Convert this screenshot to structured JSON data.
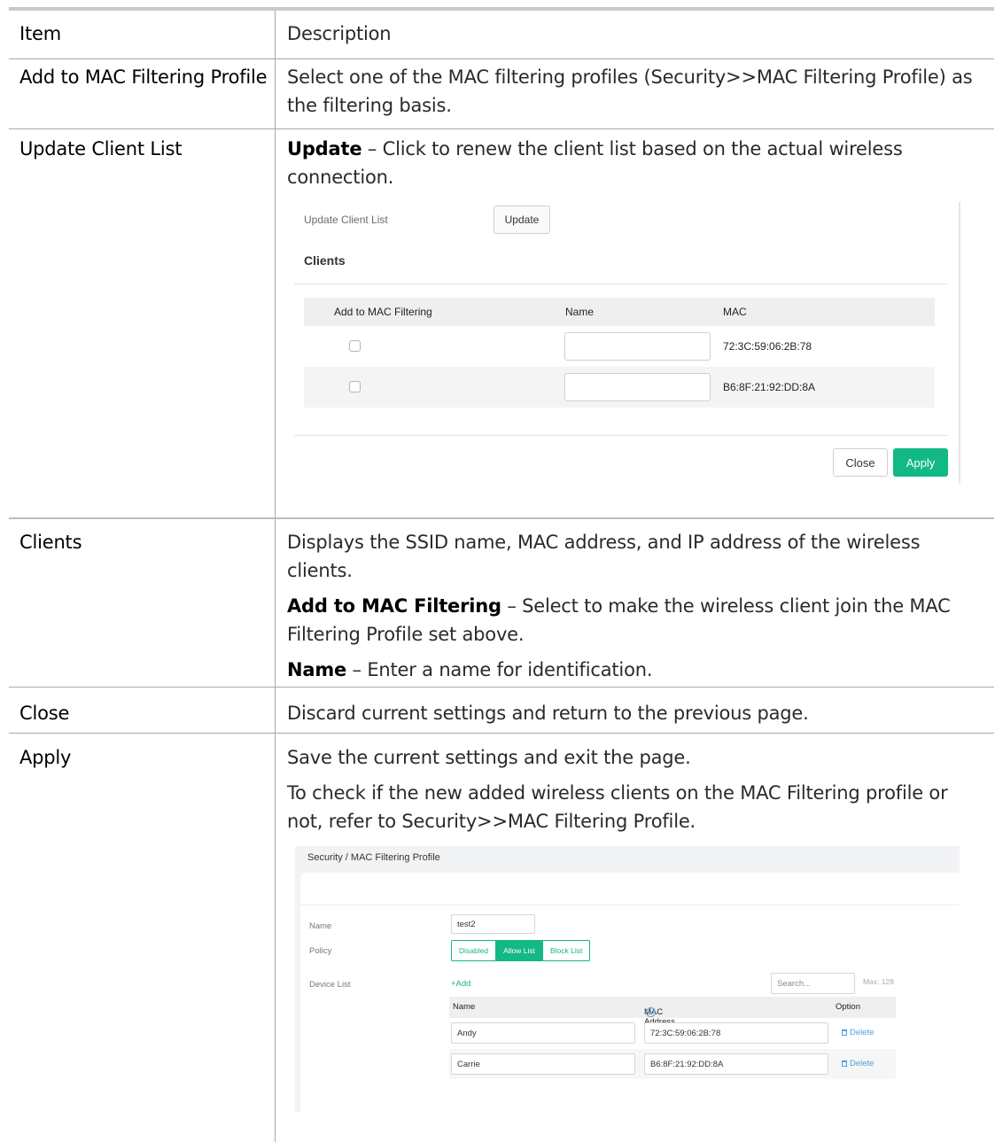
{
  "table": {
    "headers": {
      "item": "Item",
      "description": "Description"
    },
    "rows": [
      {
        "item": "Add to MAC Filtering Profile",
        "description": "Select one of the MAC filtering profiles (Security>>MAC Filtering Profile) as the filtering basis."
      },
      {
        "item": "Update Client List",
        "term": "Update",
        "description": " – Click to renew the client list based on the actual wireless connection."
      },
      {
        "item": "Clients",
        "description": "Displays the SSID name, MAC address, and IP address of the wireless clients.",
        "term2": "Add to MAC Filtering",
        "description2": " – Select to make the wireless client join the MAC Filtering Profile set above.",
        "term3": "Name",
        "description3": " – Enter a name for identification."
      },
      {
        "item": "Close",
        "description": "Discard current settings and return to the previous page."
      },
      {
        "item": "Apply",
        "description": "Save the current settings and exit the page.",
        "description2": "To check if the new added wireless clients on the MAC Filtering profile or not, refer to Security>>MAC Filtering Profile."
      }
    ]
  },
  "update_dialog": {
    "update_client_list_label": "Update Client List",
    "update_button": "Update",
    "clients_heading": "Clients",
    "columns": [
      "Add to MAC Filtering",
      "Name",
      "MAC"
    ],
    "rows": [
      {
        "checked": false,
        "name": "",
        "mac": "72:3C:59:06:2B:78"
      },
      {
        "checked": false,
        "name": "",
        "mac": "B6:8F:21:92:DD:8A"
      }
    ],
    "close_button": "Close",
    "apply_button": "Apply",
    "accent_color": "#12b886"
  },
  "mac_profile_page": {
    "breadcrumb": "Security / MAC Filtering Profile",
    "name_label": "Name",
    "name_value": "test2",
    "policy_label": "Policy",
    "policy_options": [
      "Disabled",
      "Allow List",
      "Block List"
    ],
    "policy_selected": "Allow List",
    "device_list_label": "Device List",
    "add_label": "+Add",
    "search_placeholder": "Search...",
    "max_label": "Max: 128",
    "columns": [
      "Name",
      "MAC Address",
      "Option"
    ],
    "devices": [
      {
        "name": "Andy",
        "mac": "72:3C:59:06:2B:78",
        "action": "Delete"
      },
      {
        "name": "Carrie",
        "mac": "B6:8F:21:92:DD:8A",
        "action": "Delete"
      }
    ]
  }
}
